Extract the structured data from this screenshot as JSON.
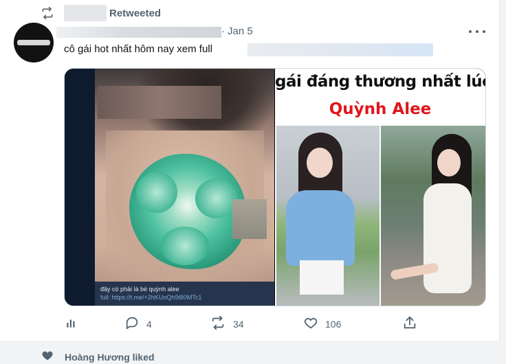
{
  "header": {
    "retweeted_label": "Retweeted"
  },
  "tweet": {
    "date": "Jan 5",
    "separator": "·",
    "text": "cô gái hot nhất hôm nay xem full",
    "media": {
      "left_caption_line1": "đây có phải là bé quỳnh alee",
      "left_caption_line2": "full: https://t.me/+2hKUoQh9t80MTc1",
      "right_title": "gái đáng thương nhất lúc n",
      "right_name": "Quỳnh Alee"
    }
  },
  "actions": {
    "replies": "4",
    "retweets": "34",
    "likes": "106"
  },
  "next_item": {
    "liked_text": "Hoàng Hương liked"
  },
  "icons": {
    "retweet": "retweet-icon",
    "more": "more-icon",
    "analytics": "analytics-icon",
    "reply": "reply-icon",
    "like": "heart-icon",
    "share": "share-icon"
  },
  "colors": {
    "secondary_text": "#536471",
    "accent_red": "#e0161b"
  }
}
